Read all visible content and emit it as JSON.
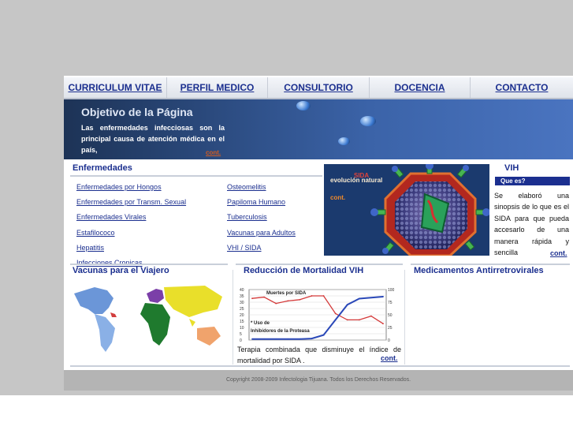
{
  "nav": [
    "CURRICULUM VITAE",
    "PERFIL MEDICO",
    "CONSULTORIO",
    "DOCENCIA",
    "CONTACTO"
  ],
  "banner": {
    "title": "Objetivo de la Página",
    "text": "Las enfermedades infecciosas son la principal causa de atención médica en el país,",
    "link": "cont."
  },
  "enfermedades": {
    "heading": "Enfermedades",
    "left": [
      "Enfermedades por Hongos",
      "Enfermedades por Transm. Sexual",
      "Enfermedades Virales",
      "Estafilococo",
      "Hepatitis",
      "Infecciones Cronicas"
    ],
    "right": [
      "Osteomelitis",
      "Papiloma Humano",
      "Tuberculosis",
      "Vacunas para Adultos",
      "VHI / SIDA"
    ]
  },
  "virus": {
    "label": "evolución natural",
    "overlay": "SIDA",
    "link": "cont."
  },
  "vih": {
    "heading": "VIH",
    "sub": "Que es?",
    "text": "Se elaboró una sinopsis de lo que es el SIDA para que pueda accesarlo de una manera rápida y sencilla",
    "link": "cont."
  },
  "vacunas": {
    "heading": "Vacunas para el Viajero"
  },
  "mortalidad": {
    "heading": "Reducción de Mortalidad VIH",
    "caption": "Terapia combinada que disminuye el índice de mortalidad por SIDA .",
    "link": "cont."
  },
  "medicamentos": {
    "heading": "Medicamentos Antirretrovirales"
  },
  "chart_data": {
    "type": "line",
    "series": [
      {
        "name": "Muertes por SIDA",
        "color": "#d43a3a",
        "values": [
          33,
          34,
          29,
          31,
          32,
          35,
          35,
          21,
          16,
          16,
          19,
          13
        ]
      },
      {
        "name": "Uso de Inhibidores de la Proteasa",
        "color": "#2a48b8",
        "values": [
          2,
          2,
          2,
          2,
          2,
          3,
          10,
          40,
          70,
          82,
          84,
          86
        ]
      }
    ],
    "left_axis": [
      0,
      5,
      10,
      15,
      20,
      25,
      30,
      35,
      40
    ],
    "right_axis": [
      0,
      25,
      50,
      75,
      100
    ],
    "ylim_left": [
      0,
      40
    ],
    "ylim_right": [
      0,
      100
    ],
    "annot_top": "Muertes por SIDA",
    "annot_bottom_1": "* Uso de",
    "annot_bottom_2": "Inhibidores de la Proteasa"
  },
  "footer": "Copyright 2008-2009 Infectologia Tijuana. Todos los Derechos Reservados."
}
